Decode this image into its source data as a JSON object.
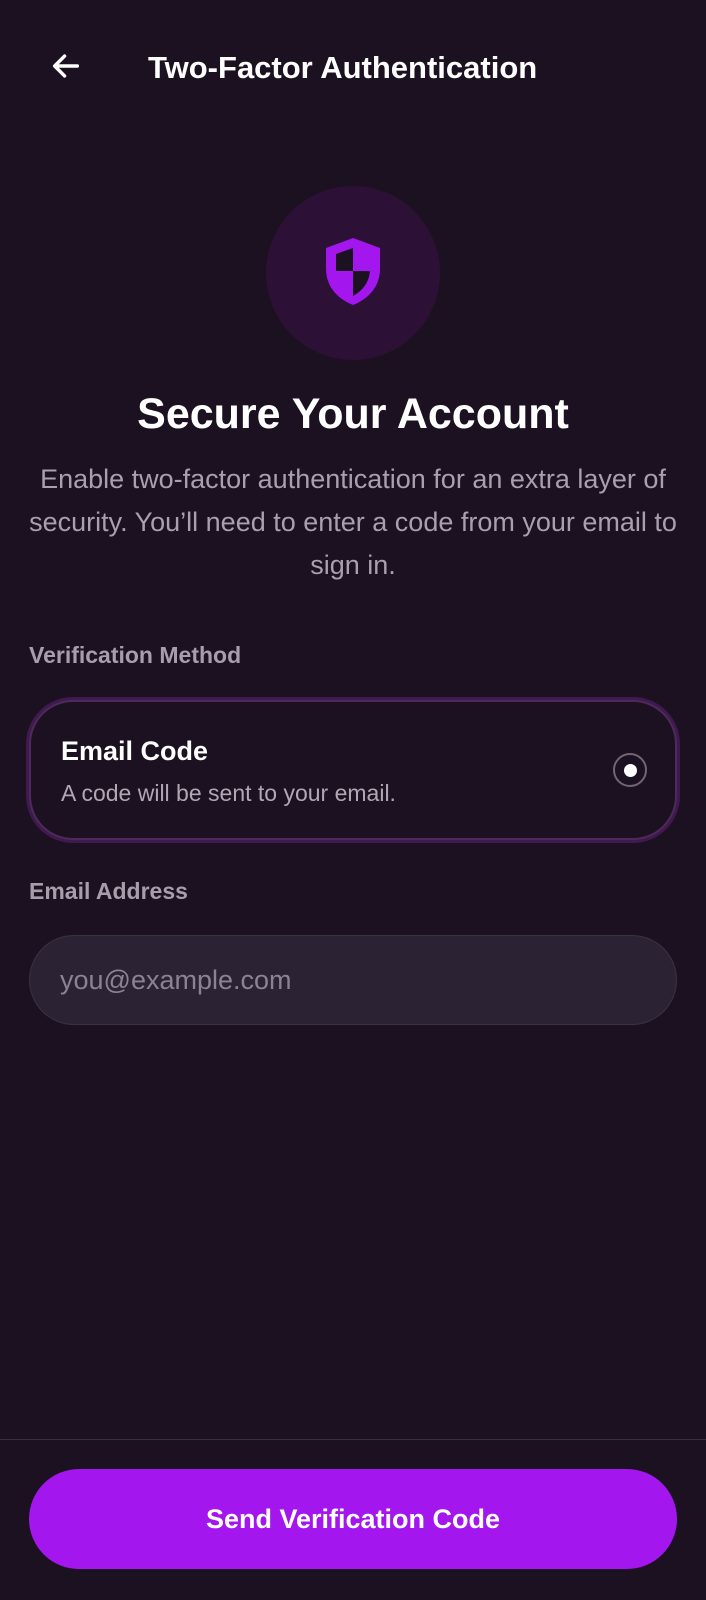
{
  "header": {
    "back_icon": "arrow-left-icon",
    "title": "Two-Factor Authentication"
  },
  "hero": {
    "icon": "shield-icon",
    "title": "Secure Your Account",
    "description": "Enable two-factor authentication for an extra layer of security. You’ll need to enter a code from your email to sign in."
  },
  "verification": {
    "label": "Verification Method",
    "option": {
      "title": "Email Code",
      "subtitle": "A code will be sent to your email.",
      "selected": true
    }
  },
  "email": {
    "label": "Email Address",
    "placeholder": "you@example.com",
    "value": ""
  },
  "footer": {
    "button_label": "Send Verification Code"
  },
  "colors": {
    "background": "#1c1120",
    "accent": "#a316ee",
    "icon_circle": "#2d1036",
    "input_bg": "#2b2233",
    "muted_text": "#a99fad"
  }
}
